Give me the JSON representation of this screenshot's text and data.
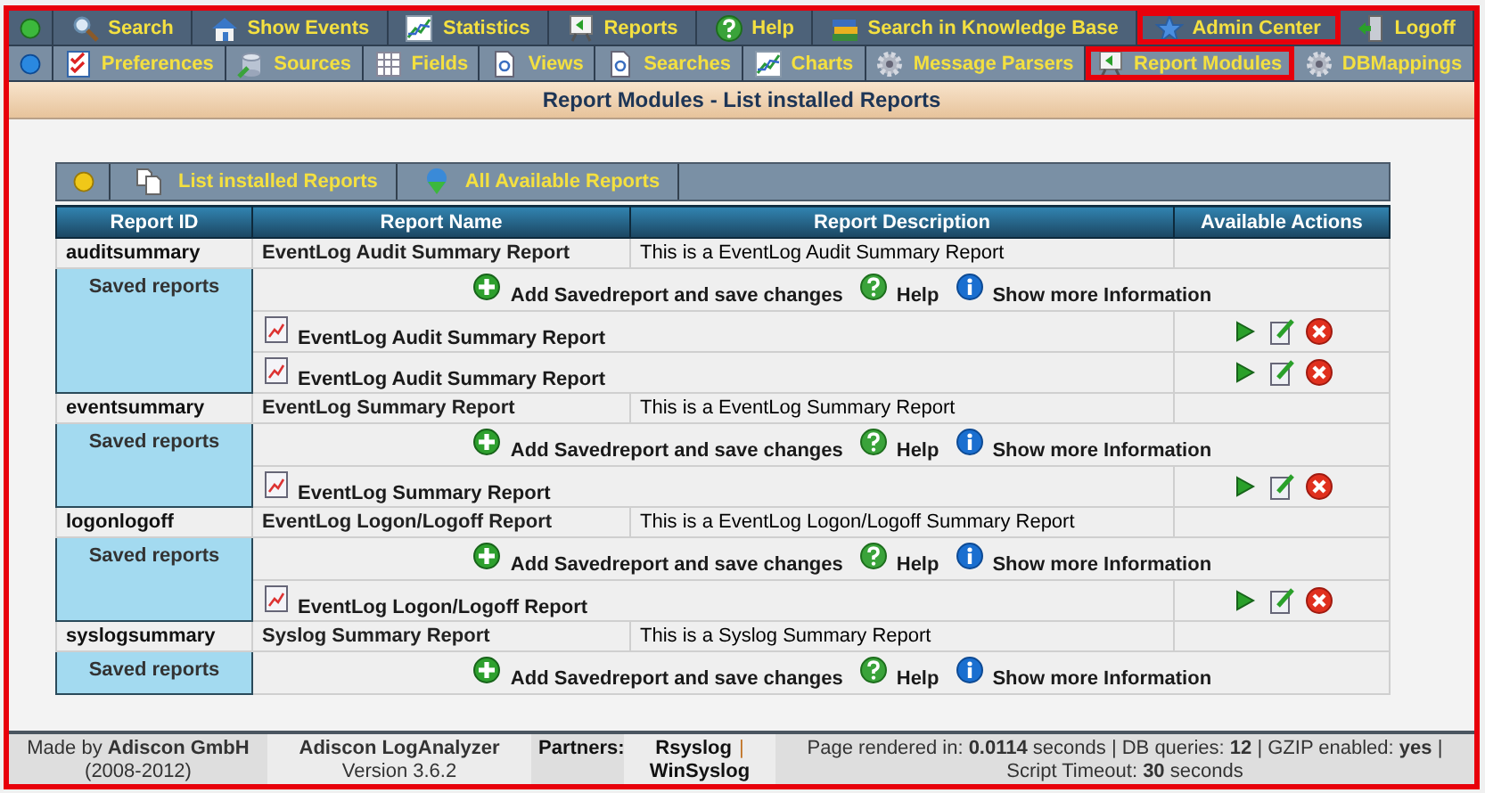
{
  "menu": {
    "rows": [
      {
        "items": [
          {
            "label": "Search",
            "highlighted": false
          },
          {
            "label": "Show Events",
            "highlighted": false
          },
          {
            "label": "Statistics",
            "highlighted": false
          },
          {
            "label": "Reports",
            "highlighted": false
          },
          {
            "label": "Help",
            "highlighted": false
          },
          {
            "label": "Search in Knowledge Base",
            "highlighted": false
          },
          {
            "label": "Admin Center",
            "highlighted": true
          },
          {
            "label": "Logoff",
            "highlighted": false
          }
        ]
      },
      {
        "items": [
          {
            "label": "Preferences",
            "highlighted": false
          },
          {
            "label": "Sources",
            "highlighted": false
          },
          {
            "label": "Fields",
            "highlighted": false
          },
          {
            "label": "Views",
            "highlighted": false
          },
          {
            "label": "Searches",
            "highlighted": false
          },
          {
            "label": "Charts",
            "highlighted": false
          },
          {
            "label": "Message Parsers",
            "highlighted": false
          },
          {
            "label": "Report Modules",
            "highlighted": true
          },
          {
            "label": "DBMappings",
            "highlighted": false
          }
        ]
      }
    ]
  },
  "page_title": "Report Modules - List installed Reports",
  "tabs": [
    {
      "label": "List installed Reports"
    },
    {
      "label": "All Available Reports"
    }
  ],
  "table": {
    "columns": [
      "Report ID",
      "Report Name",
      "Report Description",
      "Available Actions"
    ],
    "rows": [
      {
        "id": "auditsummary",
        "name": "EventLog Audit Summary Report",
        "description": "This is a EventLog Audit Summary Report",
        "saved_label": "Saved reports",
        "add_label": "Add Savedreport and save changes",
        "help_label": "Help",
        "info_label": "Show more Information",
        "saved_reports": [
          {
            "name": "EventLog Audit Summary Report"
          },
          {
            "name": "EventLog Audit Summary Report"
          }
        ]
      },
      {
        "id": "eventsummary",
        "name": "EventLog Summary Report",
        "description": "This is a EventLog Summary Report",
        "saved_label": "Saved reports",
        "add_label": "Add Savedreport and save changes",
        "help_label": "Help",
        "info_label": "Show more Information",
        "saved_reports": [
          {
            "name": "EventLog Summary Report"
          }
        ]
      },
      {
        "id": "logonlogoff",
        "name": "EventLog Logon/Logoff Report",
        "description": "This is a EventLog Logon/Logoff Summary Report",
        "saved_label": "Saved reports",
        "add_label": "Add Savedreport and save changes",
        "help_label": "Help",
        "info_label": "Show more Information",
        "saved_reports": [
          {
            "name": "EventLog Logon/Logoff Report"
          }
        ]
      },
      {
        "id": "syslogsummary",
        "name": "Syslog Summary Report",
        "description": "This is a Syslog Summary Report",
        "saved_label": "Saved reports",
        "add_label": "Add Savedreport and save changes",
        "help_label": "Help",
        "info_label": "Show more Information",
        "saved_reports": []
      }
    ]
  },
  "footer": {
    "made_by": "Made by **Adiscon GmbH** (2008-2012)",
    "version": "**Adiscon LogAnalyzer** Version 3.6.2",
    "partners_label": "Partners:",
    "partners": [
      "Rsyslog",
      "WinSyslog"
    ],
    "partner_separator": "|",
    "stats": "Page rendered in: **0.0114** seconds | DB queries: **12** | GZIP enabled: **yes** | Script Timeout: **30** seconds"
  }
}
